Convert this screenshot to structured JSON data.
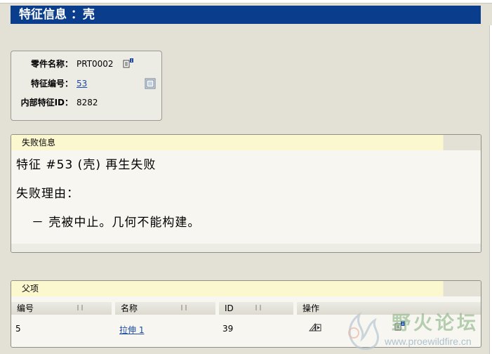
{
  "page": {
    "title": "特征信息 ：壳"
  },
  "info": {
    "part_name_label": "零件名称：",
    "part_name_value": "PRT0002",
    "feature_number_label": "特征编号：",
    "feature_number_value": "53",
    "internal_id_label": "内部特征ID：",
    "internal_id_value": "8282"
  },
  "failure": {
    "header": "失败信息",
    "line1": "特征 #53 (壳) 再生失败",
    "line2": "失败理由：",
    "line3": "－ 壳被中止。几何不能构建。"
  },
  "parents": {
    "header": "父项",
    "columns": [
      "编号",
      "名称",
      "ID",
      "操作"
    ],
    "rows": [
      {
        "number": "5",
        "name": "拉伸 1",
        "id": "39"
      }
    ]
  },
  "watermark": {
    "title": "野火论坛",
    "url": "www.proewildfire.cn"
  },
  "colors": {
    "title_bar": "#0a3e8c",
    "link": "#1b4aa8",
    "panel_header": "#fbf7cf",
    "background": "#e3e1d6"
  },
  "icons": {
    "copy": "copy-icon",
    "info": "info-icon",
    "edit_definition": "edit-definition-icon",
    "info_small": "info-small-icon"
  }
}
